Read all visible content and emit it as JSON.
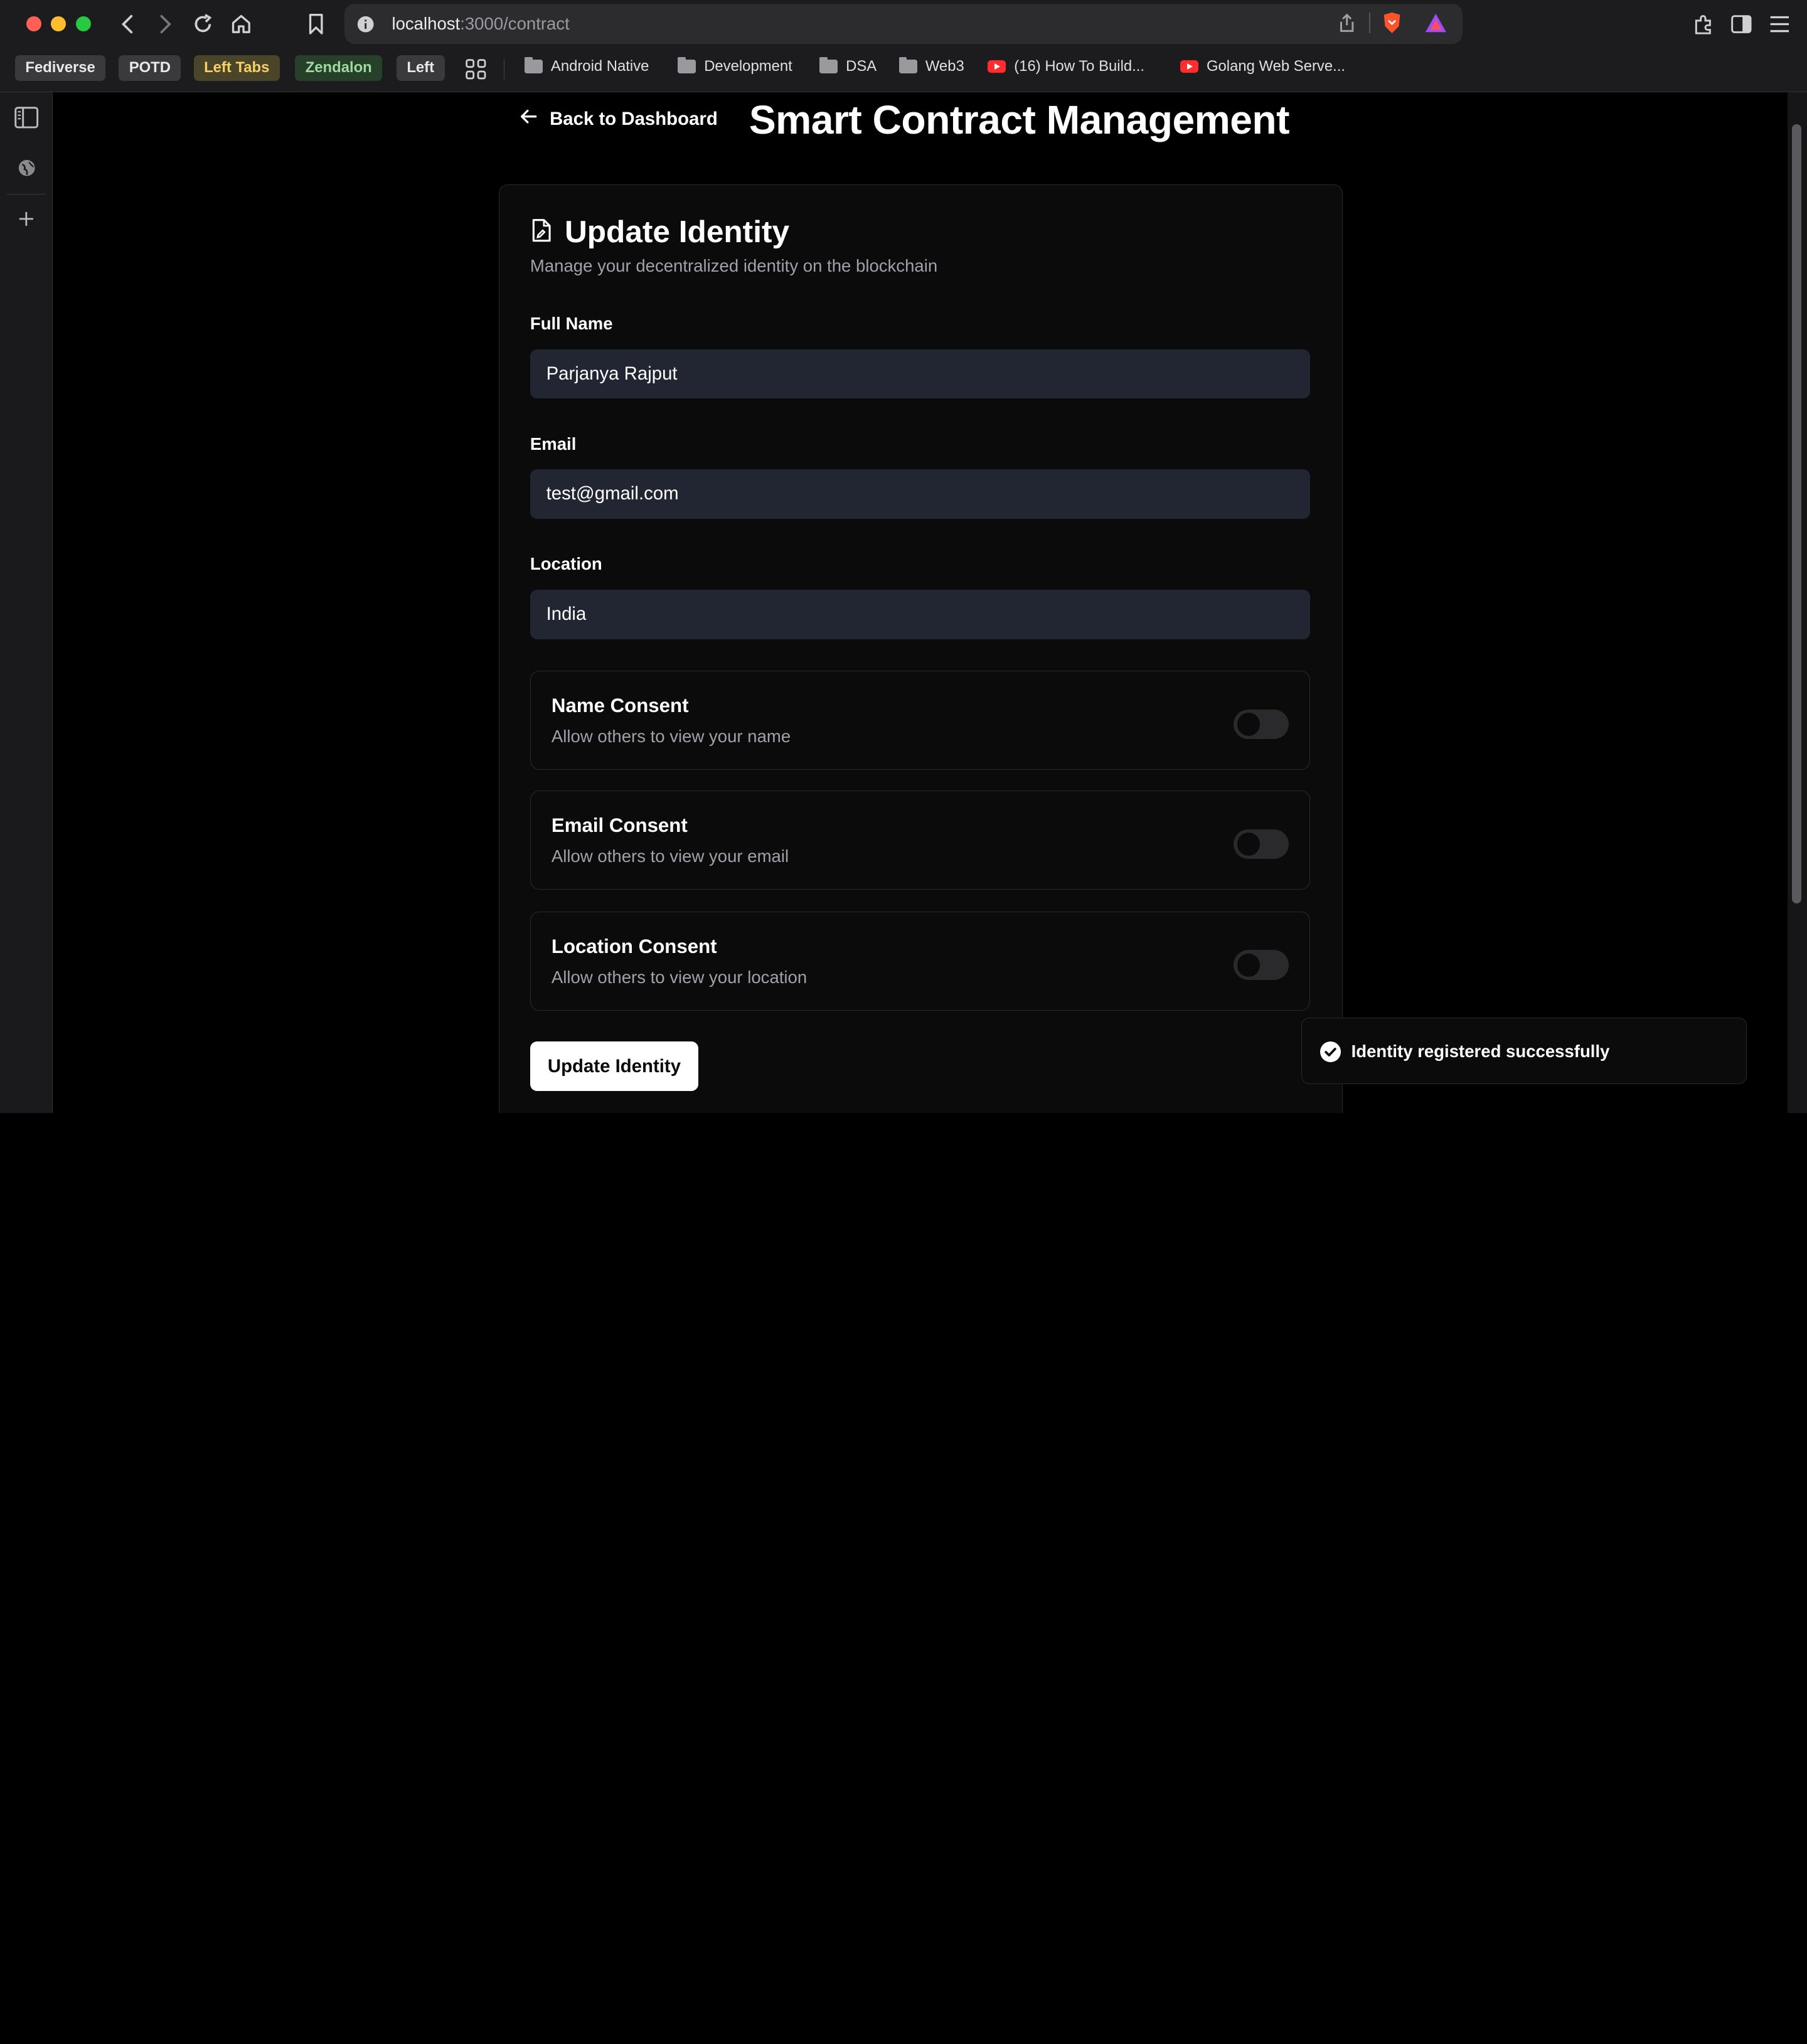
{
  "browser": {
    "url_host": "localhost",
    "url_path": ":3000/contract"
  },
  "bookmarks": {
    "chips": [
      {
        "label": "Fediverse",
        "color": "#e8e8e8",
        "bg": "#3a3a3c"
      },
      {
        "label": "POTD",
        "color": "#e8e8e8",
        "bg": "#3a3a3c"
      },
      {
        "label": "Left Tabs",
        "color": "#f5cf6a",
        "bg": "#4a4428"
      },
      {
        "label": "Zendalon",
        "color": "#9fd8a0",
        "bg": "#26402a"
      },
      {
        "label": "Left",
        "color": "#e8e8e8",
        "bg": "#3a3a3c"
      }
    ],
    "items": [
      {
        "label": "Android Native",
        "icon": "folder-icon"
      },
      {
        "label": "Development",
        "icon": "folder-icon"
      },
      {
        "label": "DSA",
        "icon": "folder-icon"
      },
      {
        "label": "Web3",
        "icon": "folder-icon"
      },
      {
        "label": "(16) How To Build...",
        "icon": "youtube-icon"
      },
      {
        "label": "Golang Web Serve...",
        "icon": "youtube-icon"
      }
    ]
  },
  "page": {
    "back_label": "Back to Dashboard",
    "title": "Smart Contract Management"
  },
  "card": {
    "title": "Update Identity",
    "subtitle": "Manage your decentralized identity on the blockchain",
    "fields": [
      {
        "label": "Full Name",
        "value": "Parjanya Rajput"
      },
      {
        "label": "Email",
        "value": "test@gmail.com"
      },
      {
        "label": "Location",
        "value": "India"
      }
    ],
    "consents": [
      {
        "title": "Name Consent",
        "description": "Allow others to view your name",
        "enabled": false
      },
      {
        "title": "Email Consent",
        "description": "Allow others to view your email",
        "enabled": false
      },
      {
        "title": "Location Consent",
        "description": "Allow others to view your location",
        "enabled": false
      }
    ],
    "submit_label": "Update Identity"
  },
  "toast": {
    "message": "Identity registered successfully"
  }
}
